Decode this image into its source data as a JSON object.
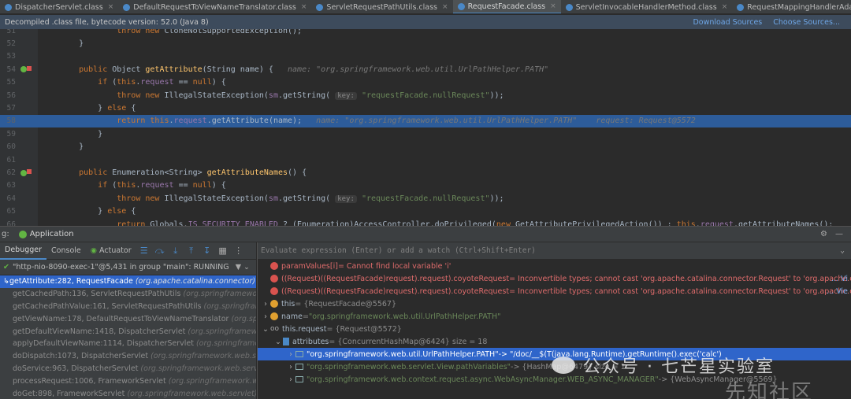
{
  "tabs": [
    {
      "label": "DispatcherServlet.class",
      "active": false
    },
    {
      "label": "DefaultRequestToViewNameTranslator.class",
      "active": false
    },
    {
      "label": "ServletRequestPathUtils.class",
      "active": false
    },
    {
      "label": "RequestFacade.class",
      "active": true
    },
    {
      "label": "ServletInvocableHandlerMethod.class",
      "active": false
    },
    {
      "label": "RequestMappingHandlerAdapter.class",
      "active": false
    }
  ],
  "banner": {
    "text": "Decompiled .class file, bytecode version: 52.0 (Java 8)",
    "download": "Download Sources",
    "choose": "Choose Sources..."
  },
  "code_lines": [
    {
      "n": "51",
      "html": "            <span class='kw'>throw new</span> CloneNotSupportedException();"
    },
    {
      "n": "52",
      "html": "    }"
    },
    {
      "n": "53",
      "html": ""
    },
    {
      "n": "54",
      "html": "    <span class='kw'>public</span> Object <span class='fn'>getAttribute</span>(String name) {   <span class='hint'>name: \"org.springframework.web.util.UrlPathHelper.PATH\"</span>",
      "mark": true
    },
    {
      "n": "55",
      "html": "        <span class='kw'>if</span> (<span class='kw'>this</span>.<span class='fld'>request</span> == <span class='kw'>null</span>) {"
    },
    {
      "n": "56",
      "html": "            <span class='kw'>throw new</span> IllegalStateException(<span class='fld'>sm</span>.getString( <span class='pill'>key:</span> <span class='str'>\"requestFacade.nullRequest\"</span>));"
    },
    {
      "n": "57",
      "html": "        } <span class='kw'>else</span> {"
    },
    {
      "n": "58",
      "html": "            <span class='kw'>return</span> <span class='kw'>this</span>.<span class='fld'>request</span>.getAttribute(name);   <span class='hint'>name: \"org.springframework.web.util.UrlPathHelper.PATH\"    request: Request@5572</span>",
      "hl": true
    },
    {
      "n": "59",
      "html": "        }"
    },
    {
      "n": "60",
      "html": "    }"
    },
    {
      "n": "61",
      "html": ""
    },
    {
      "n": "62",
      "html": "    <span class='kw'>public</span> Enumeration&lt;String&gt; <span class='fn'>getAttributeNames</span>() {",
      "mark": true
    },
    {
      "n": "63",
      "html": "        <span class='kw'>if</span> (<span class='kw'>this</span>.<span class='fld'>request</span> == <span class='kw'>null</span>) {"
    },
    {
      "n": "64",
      "html": "            <span class='kw'>throw new</span> IllegalStateException(<span class='fld'>sm</span>.getString( <span class='pill'>key:</span> <span class='str'>\"requestFacade.nullRequest\"</span>));"
    },
    {
      "n": "65",
      "html": "        } <span class='kw'>else</span> {"
    },
    {
      "n": "66",
      "html": "            <span class='kw'>return</span> Globals.<span class='fld'>IS_SECURITY_ENABLED</span> ? (Enumeration)AccessController.doPrivileged(<span class='kw'>new</span> GetAttributePrivilegedAction()) : <span class='kw'>this</span>.<span class='fld'>request</span>.getAttributeNames();"
    }
  ],
  "debug": {
    "label": "g:",
    "app_tab": "Application",
    "tabs": [
      "Debugger",
      "Console",
      "Actuator"
    ],
    "thread": "\"http-nio-8090-exec-1\"@5,431 in group \"main\": RUNNING",
    "eval_placeholder": "Evaluate expression (Enter) or add a watch (Ctrl+Shift+Enter)"
  },
  "frames": [
    {
      "m": "getAttribute:282, RequestFacade",
      "p": "(org.apache.catalina.connector)",
      "sel": true
    },
    {
      "m": "getCachedPath:136, ServletRequestPathUtils",
      "p": "(org.springframework.we"
    },
    {
      "m": "getCachedPathValue:161, ServletRequestPathUtils",
      "p": "(org.springframewo"
    },
    {
      "m": "getViewName:178, DefaultRequestToViewNameTranslator",
      "p": "(org.springfra"
    },
    {
      "m": "getDefaultViewName:1418, DispatcherServlet",
      "p": "(org.springframework.we"
    },
    {
      "m": "applyDefaultViewName:1114, DispatcherServlet",
      "p": "(org.springframework."
    },
    {
      "m": "doDispatch:1073, DispatcherServlet",
      "p": "(org.springframework.web.servlet)"
    },
    {
      "m": "doService:963, DispatcherServlet",
      "p": "(org.springframework.web.servlet)"
    },
    {
      "m": "processRequest:1006, FrameworkServlet",
      "p": "(org.springframework.web.se"
    },
    {
      "m": "doGet:898, FrameworkServlet",
      "p": "(org.springframework.web.servlet)"
    }
  ],
  "vars": [
    {
      "kind": "err",
      "name": "paramValues[i]",
      "val": " = Cannot find local variable 'i'"
    },
    {
      "kind": "err",
      "name": "((Request)((RequestFacade)request).request).coyoteRequest",
      "val": " = Inconvertible types; cannot cast 'org.apache.catalina.connector.Request' to 'org.apache.catalina.c",
      "link": "... Vi"
    },
    {
      "kind": "err",
      "name": "((Request)((RequestFacade)request).request).coyoteRequest",
      "val": " = Inconvertible types; cannot cast 'org.apache.catalina.connector.Request' to 'org.apache.catalina.c",
      "link": "... Vie"
    },
    {
      "kind": "obj",
      "arrow": "›",
      "name": "this",
      "val": " = {RequestFacade@5567}"
    },
    {
      "kind": "obj",
      "arrow": "›",
      "name": "name",
      "val": " = ",
      "str": "\"org.springframework.web.util.UrlPathHelper.PATH\""
    },
    {
      "kind": "oo",
      "arrow": "⌄",
      "name": "this.request",
      "val": " = {Request@5572}"
    },
    {
      "kind": "map",
      "arrow": "⌄",
      "indent": 16,
      "name": "attributes",
      "val": " = {ConcurrentHashMap@6424}  size = 18"
    },
    {
      "kind": "ent",
      "arrow": "›",
      "indent": 32,
      "str": "\"org.springframework.web.util.UrlPathHelper.PATH\"",
      "val": " -> \"/doc/__$(T(java.lang.Runtime).getRuntime().exec('calc')"
    },
    {
      "kind": "ent",
      "arrow": "›",
      "indent": 32,
      "str": "\"org.springframework.web.servlet.View.pathVariables\"",
      "val": " -> {HashMap@6479}  size = 1"
    },
    {
      "kind": "ent",
      "arrow": "›",
      "indent": 32,
      "str": "\"org.springframework.web.context.request.async.WebAsyncManager.WEB_ASYNC_MANAGER\"",
      "val": " -> {WebAsyncManager@5569}"
    }
  ],
  "watermark": {
    "text": "公众号 · 七芒星实验室",
    "text2": "先知社区"
  }
}
